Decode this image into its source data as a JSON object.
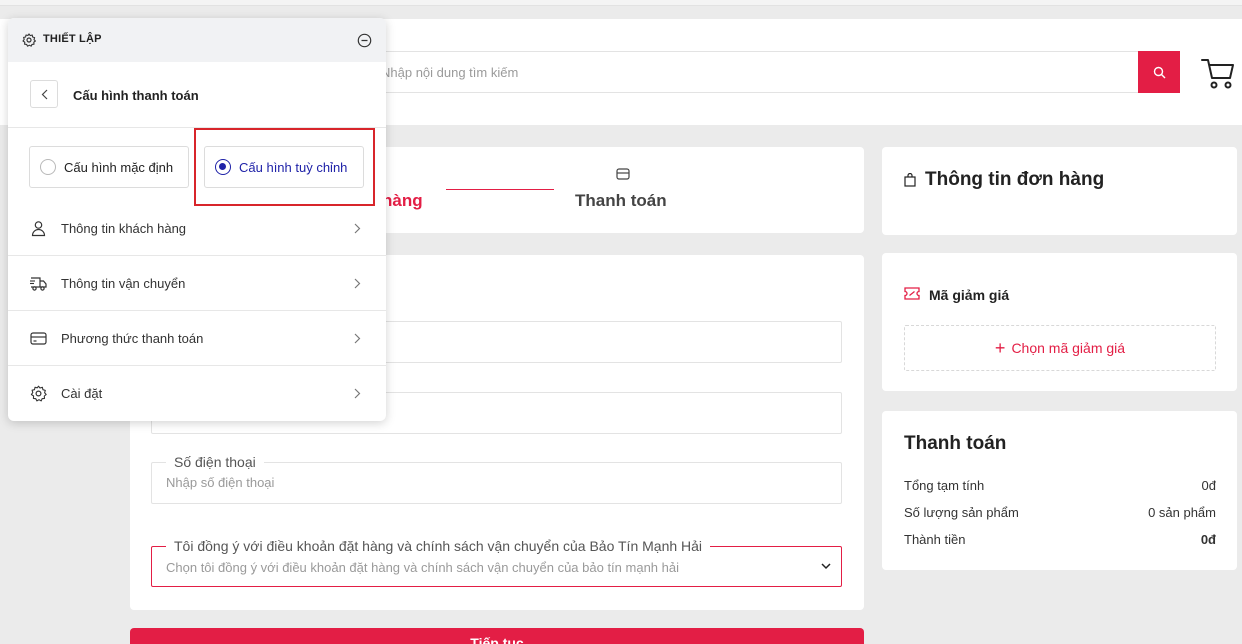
{
  "header": {
    "search_placeholder": "Nhập nội dung tìm kiếm"
  },
  "steps": {
    "active_label": "Thông tin giao hàng",
    "active_label_visible": "hàng",
    "payment_label": "Thanh toán"
  },
  "form": {
    "phone_legend": "Số điện thoại",
    "phone_placeholder": "Nhập số điện thoại",
    "terms_legend": "Tôi đồng ý với điều khoản đặt hàng và chính sách vận chuyển của Bảo Tín Mạnh Hải",
    "terms_placeholder": "Chọn tôi đồng ý với điều khoản đặt hàng và chính sách vận chuyển của bảo tín mạnh hải",
    "submit_label": "Tiếp tục"
  },
  "order": {
    "title": "Thông tin đơn hàng"
  },
  "coupon": {
    "title": "Mã giảm giá",
    "button_label": "Chọn mã giảm giá"
  },
  "payment": {
    "title": "Thanh toán",
    "rows": [
      {
        "label": "Tổng tạm tính",
        "value": "0đ"
      },
      {
        "label": "Số lượng sản phẩm",
        "value": "0 sản phẩm"
      },
      {
        "label": "Thành tiền",
        "value": "0đ"
      }
    ]
  },
  "panel": {
    "title": "THIẾT LẬP",
    "subtitle": "Cấu hình thanh toán",
    "options": [
      {
        "label": "Cấu hình mặc định",
        "selected": false
      },
      {
        "label": "Cấu hình tuỳ chỉnh",
        "selected": true
      }
    ],
    "menu": [
      {
        "label": "Thông tin khách hàng",
        "icon": "user-icon"
      },
      {
        "label": "Thông tin vận chuyển",
        "icon": "truck-icon"
      },
      {
        "label": "Phương thức thanh toán",
        "icon": "card-icon"
      },
      {
        "label": "Cài đặt",
        "icon": "gear-icon"
      }
    ]
  },
  "colors": {
    "accent": "#e31e45",
    "selected": "#1f22a8",
    "highlight_box": "#d8252b"
  }
}
